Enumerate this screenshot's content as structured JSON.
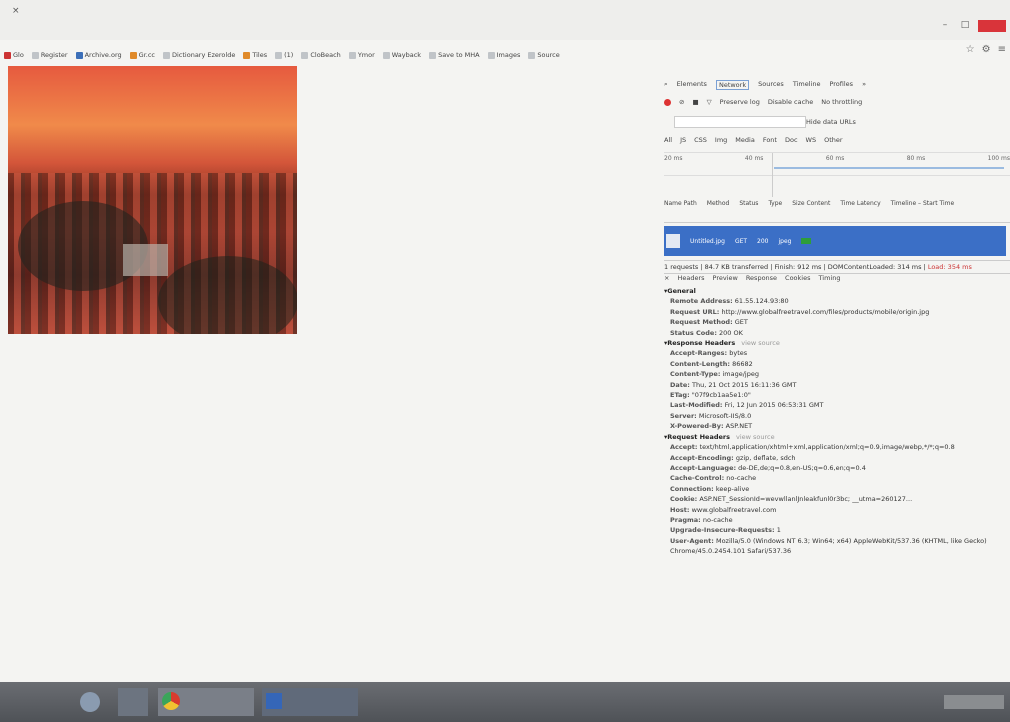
{
  "browser": {
    "tab_title": "",
    "tab_close": "×",
    "window_buttons": [
      "–",
      "□",
      ""
    ],
    "toolbar_icons": [
      "☆",
      "⚙",
      "≡"
    ]
  },
  "bookmarks": [
    "Glo",
    "Register",
    "Archive.org",
    "Gr.cc",
    "Dictionary Ezerolde",
    "Tiles",
    "(1)",
    "CloBeach",
    "Ymor",
    "Wayback",
    "Save to MHA",
    "Images",
    "Source"
  ],
  "devtools": {
    "panel_tabs": [
      "Elements",
      "Network",
      "Sources",
      "Timeline",
      "Profiles",
      "»"
    ],
    "active_tab": "Network",
    "toolbar": {
      "preserve_log": "Preserve log",
      "disable_cache": "Disable cache",
      "throttling": "No throttling"
    },
    "hide_urls": "Hide data URLs",
    "types": [
      "All",
      "JS",
      "CSS",
      "Img",
      "Media",
      "Font",
      "Doc",
      "WS",
      "Other"
    ],
    "timeline_ticks": [
      "20 ms",
      "40 ms",
      "60 ms",
      "80 ms",
      "100 ms"
    ],
    "columns": [
      "Name Path",
      "Method",
      "Status",
      "Type",
      "Size Content",
      "Time Latency",
      "Timeline – Start Time"
    ],
    "selected_request": {
      "name": "Untitled.jpg",
      "method": "GET",
      "status": "200",
      "type": "jpeg"
    },
    "status_line": {
      "text": "1 requests | 84.7 KB transferred | Finish: 912 ms | DOMContentLoaded: 314 ms | ",
      "load": "Load: 354 ms"
    },
    "detail_tabs": [
      "Headers",
      "Preview",
      "Response",
      "Cookies",
      "Timing"
    ],
    "general_title": "General",
    "general": [
      {
        "k": "Remote Address:",
        "v": "61.55.124.93:80"
      },
      {
        "k": "Request URL:",
        "v": "http://www.globalfreetravel.com/files/products/mobile/origin.jpg"
      },
      {
        "k": "Request Method:",
        "v": "GET"
      },
      {
        "k": "Status Code:",
        "v": "200 OK"
      }
    ],
    "response_title": "Response Headers",
    "response_view": "view source",
    "response": [
      {
        "k": "Accept-Ranges:",
        "v": "bytes"
      },
      {
        "k": "Content-Length:",
        "v": "86682"
      },
      {
        "k": "Content-Type:",
        "v": "image/jpeg"
      },
      {
        "k": "Date:",
        "v": "Thu, 21 Oct 2015 16:11:36 GMT"
      },
      {
        "k": "ETag:",
        "v": "\"07f9cb1aa5e1:0\""
      },
      {
        "k": "Last-Modified:",
        "v": "Fri, 12 Jun 2015 06:53:31 GMT"
      },
      {
        "k": "Server:",
        "v": "Microsoft-IIS/8.0"
      },
      {
        "k": "X-Powered-By:",
        "v": "ASP.NET"
      }
    ],
    "request_title": "Request Headers",
    "request_view": "view source",
    "request": [
      {
        "k": "Accept:",
        "v": "text/html,application/xhtml+xml,application/xml;q=0.9,image/webp,*/*;q=0.8"
      },
      {
        "k": "Accept-Encoding:",
        "v": "gzip, deflate, sdch"
      },
      {
        "k": "Accept-Language:",
        "v": "de-DE,de;q=0.8,en-US;q=0.6,en;q=0.4"
      },
      {
        "k": "Cache-Control:",
        "v": "no-cache"
      },
      {
        "k": "Connection:",
        "v": "keep-alive"
      },
      {
        "k": "Cookie:",
        "v": "ASP.NET_SessionId=wevwllanlJnleakfunl0r3bc; __utma=260127..."
      },
      {
        "k": "Host:",
        "v": "www.globalfreetravel.com"
      },
      {
        "k": "Pragma:",
        "v": "no-cache"
      },
      {
        "k": "Upgrade-Insecure-Requests:",
        "v": "1"
      },
      {
        "k": "User-Agent:",
        "v": "Mozilla/5.0 (Windows NT 6.3; Win64; x64) AppleWebKit/537.36 (KHTML, like Gecko) Chrome/45.0.2454.101 Safari/537.36"
      }
    ]
  }
}
